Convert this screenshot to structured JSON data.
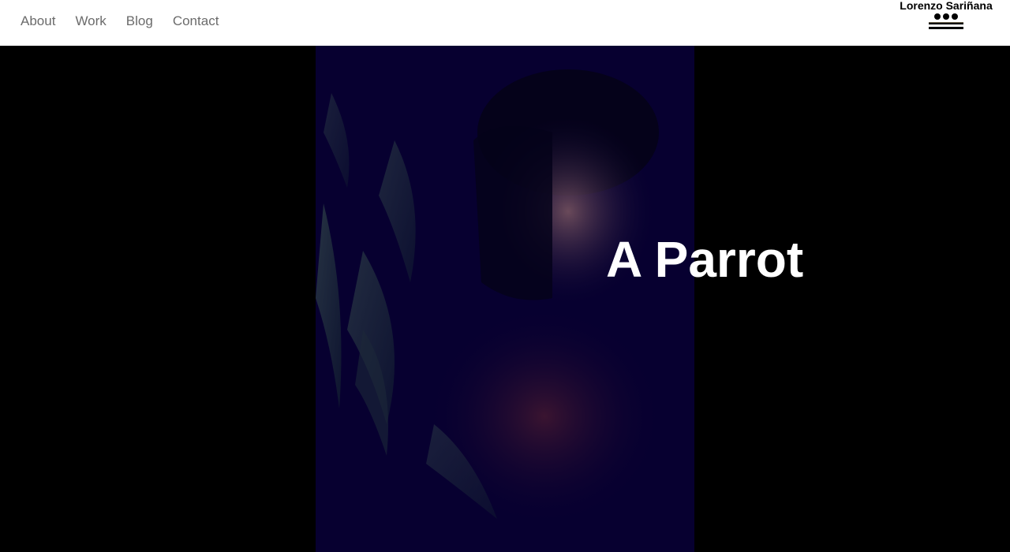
{
  "nav": {
    "items": [
      {
        "label": "About"
      },
      {
        "label": "Work"
      },
      {
        "label": "Blog"
      },
      {
        "label": "Contact"
      }
    ]
  },
  "brand": {
    "name": "Lorenzo Sariñana",
    "logo_icon": "three-dots-and-lines-logo"
  },
  "hero": {
    "title": "A Parrot",
    "image_icon": "portrait-photo"
  },
  "colors": {
    "header_bg": "#ffffff",
    "nav_text": "#6b6b6b",
    "page_bg": "#000000",
    "photo_tint": "#070030",
    "title_text": "#ffffff"
  }
}
